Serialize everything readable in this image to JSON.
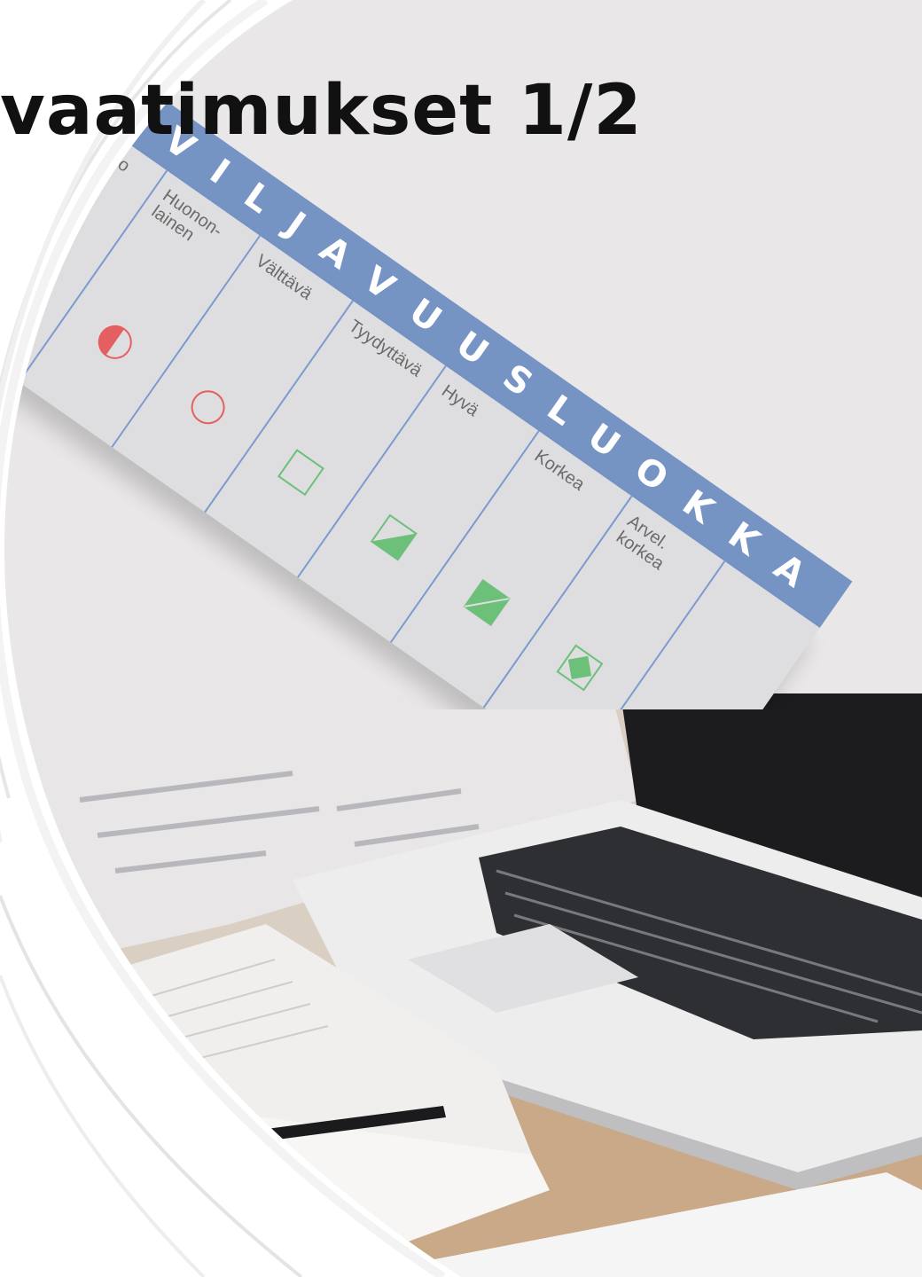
{
  "slide": {
    "title": "vaatimukset 1/2"
  },
  "strip": {
    "header_label": "VILJAVUUSLUOKKA",
    "partial_cell_label": "o",
    "cells": [
      {
        "label": "Huonon-\nlainen",
        "icon": "half-filled-red-circle-icon"
      },
      {
        "label": "Välttävä",
        "icon": "empty-red-circle-icon"
      },
      {
        "label": "Tyydyttävä",
        "icon": "empty-green-square-icon"
      },
      {
        "label": "Hyvä",
        "icon": "half-filled-green-square-icon"
      },
      {
        "label": "Korkea",
        "icon": "filled-green-square-icon"
      },
      {
        "label": "Arvel.\nkorkea",
        "icon": "filled-green-diamond-square-icon"
      }
    ],
    "colors": {
      "header": "#7593c3",
      "red": "#e45f5f",
      "green": "#6cc07a"
    }
  },
  "photo": {
    "description_icon": "laptop-desk-photo"
  }
}
